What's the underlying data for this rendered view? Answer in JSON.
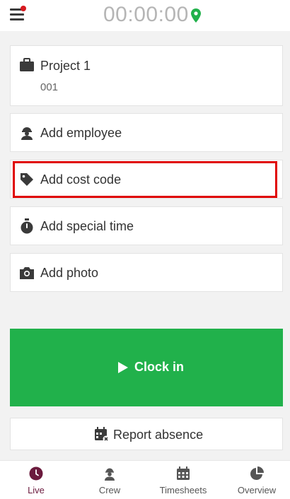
{
  "header": {
    "timer": "00:00:00"
  },
  "project": {
    "name": "Project 1",
    "code": "001"
  },
  "actions": {
    "add_employee": "Add employee",
    "add_cost_code": "Add cost code",
    "add_special_time": "Add special time",
    "add_photo": "Add photo"
  },
  "clock_in": {
    "label": "Clock in"
  },
  "report_absence": {
    "label": "Report absence"
  },
  "nav": [
    {
      "label": "Live",
      "icon": "clock-icon",
      "active": true
    },
    {
      "label": "Crew",
      "icon": "worker-icon"
    },
    {
      "label": "Timesheets",
      "icon": "calendar-icon"
    },
    {
      "label": "Overview",
      "icon": "pie-chart-icon"
    }
  ],
  "colors": {
    "accent_green": "#21b14b",
    "nav_active": "#6b1a3d",
    "highlight": "#e00000",
    "notification_dot": "#d71920",
    "location_pin": "#21b14b"
  }
}
